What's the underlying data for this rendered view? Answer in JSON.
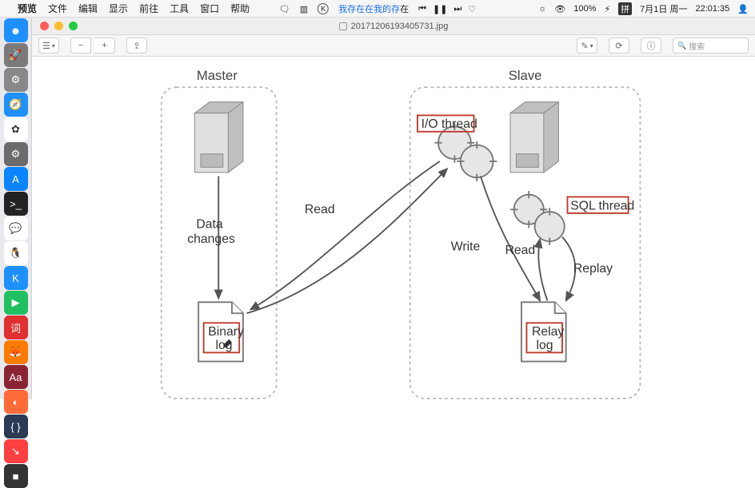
{
  "menubar": {
    "apple": "",
    "items": [
      "预览",
      "文件",
      "编辑",
      "显示",
      "前往",
      "工具",
      "窗口",
      "帮助"
    ],
    "center_link": "我存在在我的存",
    "center_tail": "在",
    "media": [
      "⏮",
      "❚❚",
      "⏭",
      "♡"
    ],
    "right": {
      "icons": [
        "☼",
        "👁",
        "100%",
        "⚡︎",
        "拼"
      ],
      "date": "7月1日 周一",
      "time": "22:01:35",
      "user": "👤"
    }
  },
  "title": {
    "filename": "20171206193405731.jpg"
  },
  "toolbar": {
    "sidebar": "☰",
    "zoom_out": "−",
    "zoom_in": "+",
    "share": "⇪",
    "markup": "✎",
    "rotate": "⟳",
    "info": "ⓘ",
    "search_placeholder": "搜索",
    "search_icon": "🔍"
  },
  "diagram": {
    "master": "Master",
    "slave": "Slave",
    "io_thread": "I/O thread",
    "sql_thread": "SQL thread",
    "data_changes_1": "Data",
    "data_changes_2": "changes",
    "read": "Read",
    "write": "Write",
    "read2": "Read",
    "replay": "Replay",
    "binary_log_1": "Binary",
    "binary_log_2": "log",
    "relay_log_1": "Relay",
    "relay_log_2": "log"
  },
  "dock": {
    "items": [
      {
        "name": "finder",
        "bg": "#1e90ff",
        "glyph": "☻"
      },
      {
        "name": "launchpad",
        "bg": "#7a7a7a",
        "glyph": "🚀"
      },
      {
        "name": "settings",
        "bg": "#888",
        "glyph": "⚙"
      },
      {
        "name": "safari",
        "bg": "#1e90ff",
        "glyph": "🧭"
      },
      {
        "name": "photos",
        "bg": "#ffffff",
        "glyph": "✿"
      },
      {
        "name": "prefs",
        "bg": "#6b6b6b",
        "glyph": "⚙"
      },
      {
        "name": "appstore",
        "bg": "#0a84ff",
        "glyph": "A"
      },
      {
        "name": "terminal",
        "bg": "#222",
        "glyph": ">_"
      },
      {
        "name": "wechat",
        "bg": "#fff",
        "glyph": "💬"
      },
      {
        "name": "qq",
        "bg": "#fff",
        "glyph": "🐧"
      },
      {
        "name": "k-app",
        "bg": "#1e90ff",
        "glyph": "K"
      },
      {
        "name": "video",
        "bg": "#20c060",
        "glyph": "▶"
      },
      {
        "name": "youdao",
        "bg": "#e03030",
        "glyph": "词"
      },
      {
        "name": "firefox",
        "bg": "#ff7b00",
        "glyph": "🦊"
      },
      {
        "name": "adobe",
        "bg": "#8a2434",
        "glyph": "Aa"
      },
      {
        "name": "postman",
        "bg": "#ff6c37",
        "glyph": "◐"
      },
      {
        "name": "code",
        "bg": "#2b3a55",
        "glyph": "{ }"
      },
      {
        "name": "todo",
        "bg": "#ff4040",
        "glyph": "↘"
      },
      {
        "name": "dark",
        "bg": "#333",
        "glyph": "■"
      }
    ]
  }
}
